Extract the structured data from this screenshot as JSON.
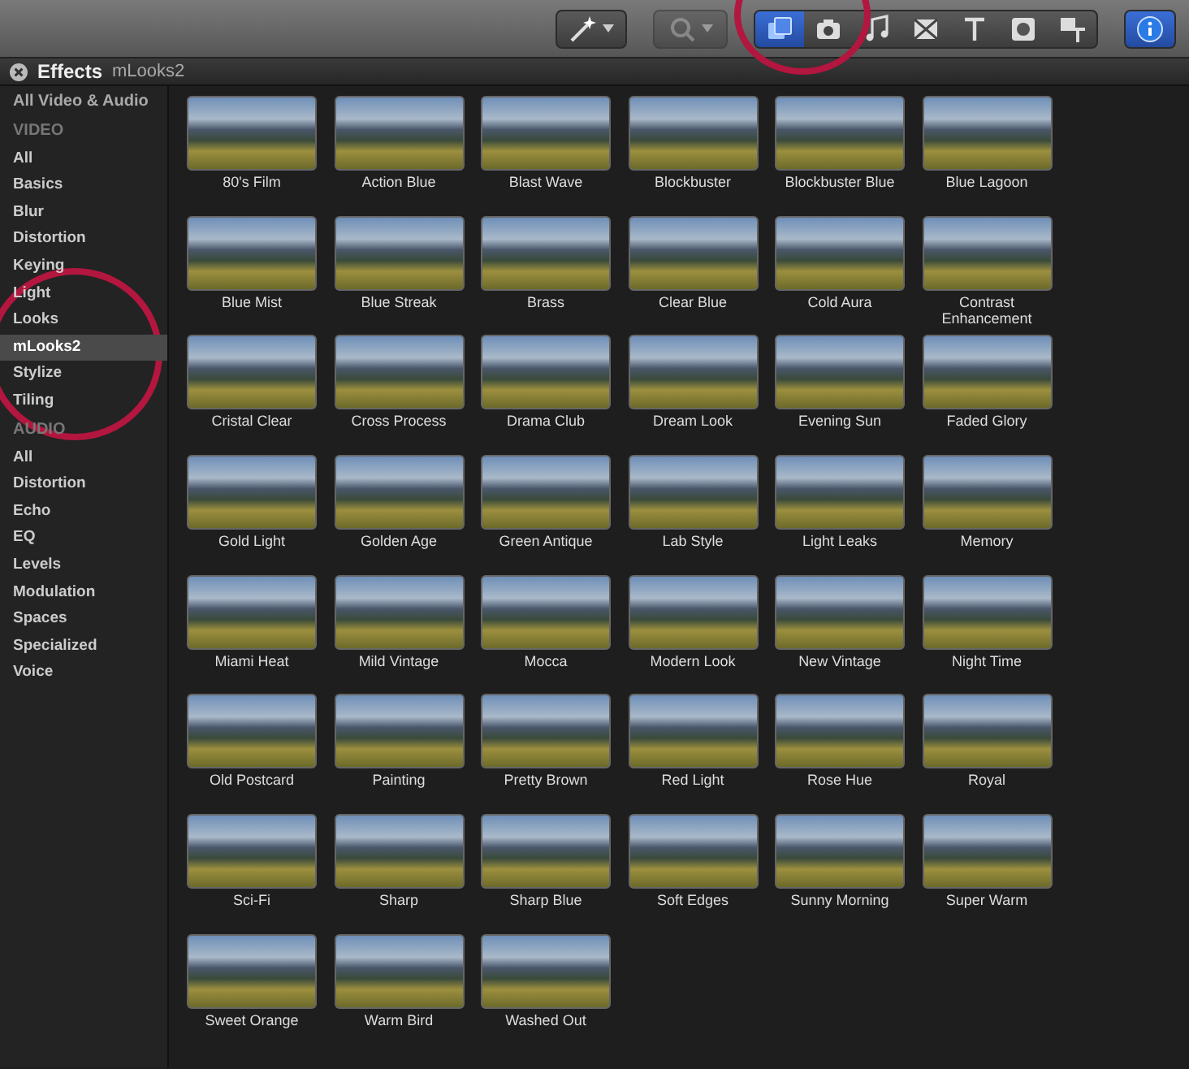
{
  "toolbar": {
    "left_buttons": [
      {
        "kind": "wand",
        "has_menu": true,
        "disabled": false
      },
      {
        "kind": "search",
        "has_menu": true,
        "disabled": true
      }
    ],
    "browser_buttons": [
      {
        "kind": "effects",
        "selected": true
      },
      {
        "kind": "photos",
        "selected": false
      },
      {
        "kind": "music",
        "selected": false
      },
      {
        "kind": "transitions",
        "selected": false
      },
      {
        "kind": "titles",
        "selected": false
      },
      {
        "kind": "generators",
        "selected": false
      },
      {
        "kind": "themes",
        "selected": false
      }
    ],
    "info_button": {
      "selected": true
    }
  },
  "panel": {
    "title": "Effects",
    "subtitle": "mLooks2"
  },
  "sidebar": {
    "top_item": {
      "label": "All Video & Audio",
      "selected": false
    },
    "sections": [
      {
        "heading": "VIDEO",
        "items": [
          {
            "label": "All",
            "selected": false
          },
          {
            "label": "Basics",
            "selected": false
          },
          {
            "label": "Blur",
            "selected": false
          },
          {
            "label": "Distortion",
            "selected": false
          },
          {
            "label": "Keying",
            "selected": false
          },
          {
            "label": "Light",
            "selected": false
          },
          {
            "label": "Looks",
            "selected": false
          },
          {
            "label": "mLooks2",
            "selected": true
          },
          {
            "label": "Stylize",
            "selected": false
          },
          {
            "label": "Tiling",
            "selected": false
          }
        ]
      },
      {
        "heading": "AUDIO",
        "items": [
          {
            "label": "All",
            "selected": false
          },
          {
            "label": "Distortion",
            "selected": false
          },
          {
            "label": "Echo",
            "selected": false
          },
          {
            "label": "EQ",
            "selected": false
          },
          {
            "label": "Levels",
            "selected": false
          },
          {
            "label": "Modulation",
            "selected": false
          },
          {
            "label": "Spaces",
            "selected": false
          },
          {
            "label": "Specialized",
            "selected": false
          },
          {
            "label": "Voice",
            "selected": false
          }
        ]
      }
    ]
  },
  "effects": [
    "80's Film",
    "Action Blue",
    "Blast Wave",
    "Blockbuster",
    "Blockbuster Blue",
    "Blue Lagoon",
    "Blue Mist",
    "Blue Streak",
    "Brass",
    "Clear Blue",
    "Cold Aura",
    "Contrast Enhancement",
    "Cristal Clear",
    "Cross Process",
    "Drama Club",
    "Dream Look",
    "Evening Sun",
    "Faded Glory",
    "Gold Light",
    "Golden Age",
    "Green Antique",
    "Lab Style",
    "Light Leaks",
    "Memory",
    "Miami Heat",
    "Mild Vintage",
    "Mocca",
    "Modern Look",
    "New Vintage",
    "Night Time",
    "Old Postcard",
    "Painting",
    "Pretty Brown",
    "Red Light",
    "Rose Hue",
    "Royal",
    "Sci-Fi",
    "Sharp",
    "Sharp Blue",
    "Soft Edges",
    "Sunny Morning",
    "Super Warm",
    "Sweet Orange",
    "Warm Bird",
    "Washed Out"
  ],
  "annotations": [
    {
      "kind": "circle"
    },
    {
      "kind": "circle"
    }
  ]
}
